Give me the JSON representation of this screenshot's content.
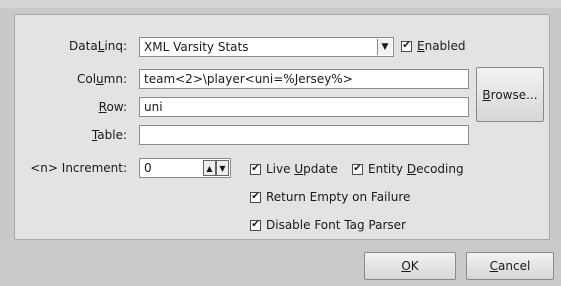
{
  "dataLinq": {
    "label_pre": "Data",
    "label_u": "L",
    "label_post": "inq:",
    "value": "XML Varsity Stats",
    "enabled_pre": "",
    "enabled_u": "E",
    "enabled_post": "nabled",
    "enabled_checked": true
  },
  "column": {
    "label_pre": "Col",
    "label_u": "u",
    "label_post": "mn:",
    "value": "team<2>\\player<uni=%Jersey%>"
  },
  "row": {
    "label_pre": "",
    "label_u": "R",
    "label_post": "ow:",
    "value": "uni"
  },
  "table": {
    "label_pre": "",
    "label_u": "T",
    "label_post": "able:",
    "value": ""
  },
  "browse": {
    "pre": "",
    "u": "B",
    "post": "rowse..."
  },
  "increment": {
    "label": "<n> Increment:",
    "value": "0"
  },
  "options": {
    "live_update": {
      "pre": "Live ",
      "u": "U",
      "post": "pdate",
      "checked": true
    },
    "entity_decoding": {
      "pre": "Entity ",
      "u": "D",
      "post": "ecoding",
      "checked": true
    },
    "return_empty": {
      "label": "Return Empty on Failure",
      "checked": true
    },
    "disable_font": {
      "label": "Disable Font Tag Parser",
      "checked": true
    }
  },
  "buttons": {
    "ok": {
      "u": "O",
      "post": "K"
    },
    "cancel": {
      "u": "C",
      "post": "ancel"
    }
  },
  "glyphs": {
    "check": "✔",
    "dropdown": "▼",
    "spin_up": "▲",
    "spin_down": "▼"
  }
}
